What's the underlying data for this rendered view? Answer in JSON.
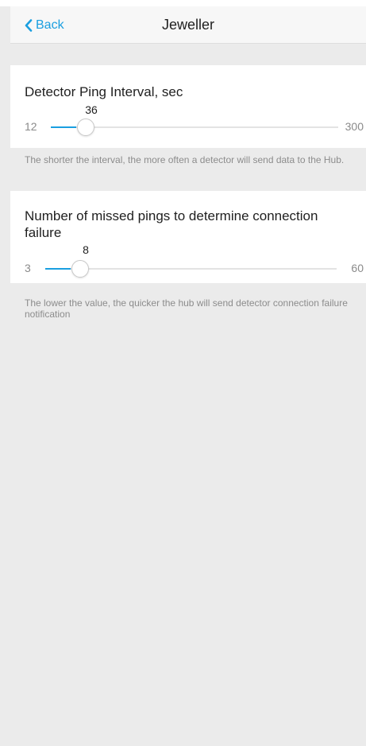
{
  "header": {
    "back_label": "Back",
    "title": "Jeweller"
  },
  "ping_interval": {
    "title": "Detector Ping Interval, sec",
    "min": "12",
    "max": "300",
    "value": "36",
    "hint": "The shorter the interval, the more often a detector will send data to the Hub."
  },
  "missed_pings": {
    "title": "Number of missed pings to determine connection failure",
    "min": "3",
    "max": "60",
    "value": "8",
    "hint": "The lower the value, the quicker the hub will send detector connection failure notification"
  },
  "colors": {
    "accent": "#1a9fe0",
    "background": "#ebebeb",
    "card": "#ffffff"
  }
}
